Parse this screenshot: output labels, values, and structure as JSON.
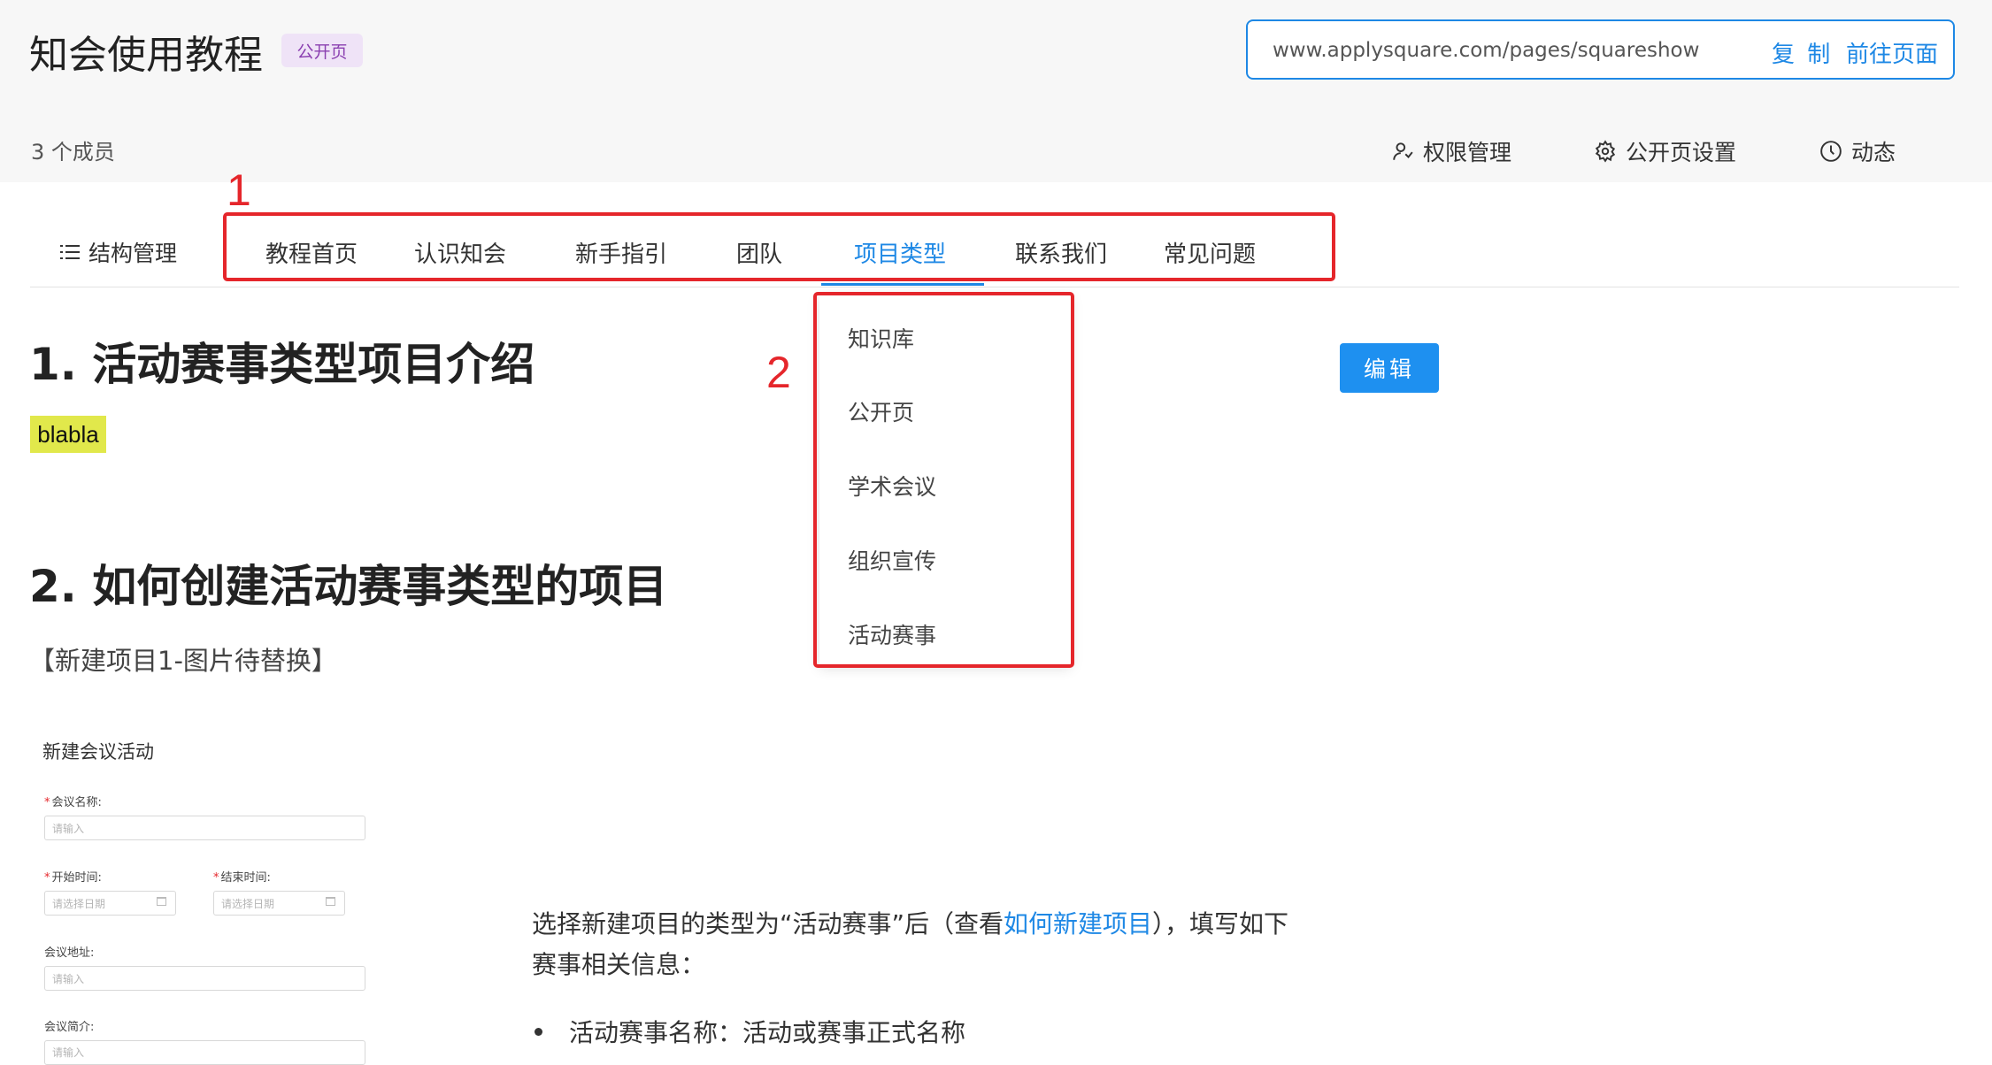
{
  "header": {
    "title": "知会使用教程",
    "badge": "公开页",
    "url": "www.applysquare.com/pages/squareshow",
    "copy_label": "复 制",
    "goto_label": "前往页面",
    "members": "3 个成员",
    "actions": [
      {
        "label": "权限管理",
        "icon": "user-permission-icon"
      },
      {
        "label": "公开页设置",
        "icon": "gear-icon"
      },
      {
        "label": "动态",
        "icon": "clock-icon"
      }
    ]
  },
  "nav": {
    "structure_label": "结构管理",
    "tabs": [
      "教程首页",
      "认识知会",
      "新手指引",
      "团队",
      "项目类型",
      "联系我们",
      "常见问题"
    ],
    "active_tab": "项目类型"
  },
  "annotations": {
    "box1": "1",
    "box2": "2"
  },
  "dropdown": {
    "items": [
      "知识库",
      "公开页",
      "学术会议",
      "组织宣传",
      "活动赛事"
    ]
  },
  "content": {
    "heading1": "1. 活动赛事类型项目介绍",
    "highlight": "blabla",
    "edit_label": "编辑",
    "heading2": "2. 如何创建活动赛事类型的项目",
    "image_note": "【新建项目1-图片待替换】",
    "form": {
      "title": "新建会议活动",
      "name_label": "会议名称:",
      "name_placeholder": "请输入",
      "start_label": "开始时间:",
      "start_placeholder": "请选择日期",
      "end_label": "结束时间:",
      "end_placeholder": "请选择日期",
      "address_label": "会议地址:",
      "address_placeholder": "请输入",
      "intro_label": "会议简介:",
      "intro_placeholder": "请输入"
    },
    "para_before_link": "选择新建项目的类型为“活动赛事”后（查看",
    "para_link": "如何新建项目",
    "para_after_link": "），填写如下赛事相关信息：",
    "bullet1": "活动赛事名称：活动或赛事正式名称"
  },
  "colors": {
    "accent": "#1e88e5",
    "annotation": "#e5262b",
    "highlight": "#e1e84b"
  }
}
